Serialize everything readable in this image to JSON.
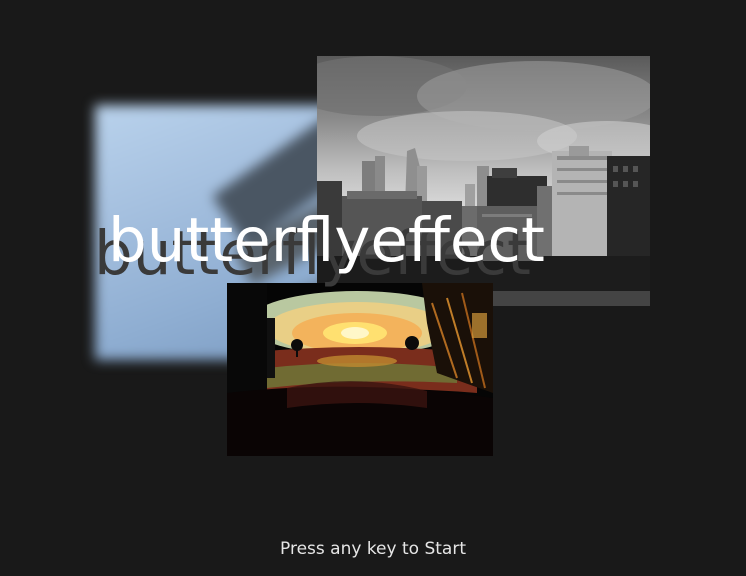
{
  "title": "butterflyeffect",
  "prompt": "Press any key to Start",
  "colors": {
    "background": "#191919",
    "title": "#ffffff",
    "title_shadow": "#3a3a3a",
    "prompt": "#e6e6e6"
  }
}
